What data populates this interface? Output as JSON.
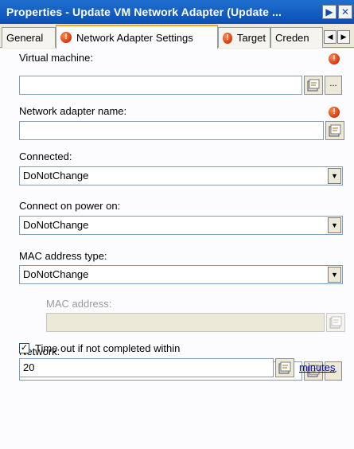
{
  "window": {
    "title": "Properties - Update VM Network Adapter (Update ...",
    "btn_scroll": "▶",
    "btn_close": "✕"
  },
  "tabs": [
    {
      "label": "General",
      "warning": false
    },
    {
      "label": "Network Adapter Settings",
      "warning": true,
      "active": true
    },
    {
      "label": "Target",
      "warning": true
    },
    {
      "label": "Creden"
    }
  ],
  "tab_scroll": {
    "left": "◀",
    "right": "▶"
  },
  "warning_glyph": "!",
  "browse_glyph": "...",
  "fields": {
    "virtual_machine": {
      "label": "Virtual machine:",
      "value": ""
    },
    "network_adapter_name": {
      "label": "Network adapter name:",
      "value": ""
    },
    "connected": {
      "label": "Connected:",
      "value": "DoNotChange"
    },
    "connect_on_power_on": {
      "label": "Connect on power on:",
      "value": "DoNotChange"
    },
    "mac_address_type": {
      "label": "MAC address type:",
      "value": "DoNotChange"
    },
    "mac_address": {
      "label": "MAC address:",
      "value": ""
    },
    "network": {
      "label": "Network:",
      "value": ""
    }
  },
  "timeout": {
    "checkbox_label": "Time out if not completed within",
    "checked": true,
    "checkmark": "✓",
    "value": "20",
    "units_link": "minutes"
  },
  "colors": {
    "titlebar": "#0a4fb6",
    "warning": "#d4380d",
    "link": "#0000cc"
  }
}
